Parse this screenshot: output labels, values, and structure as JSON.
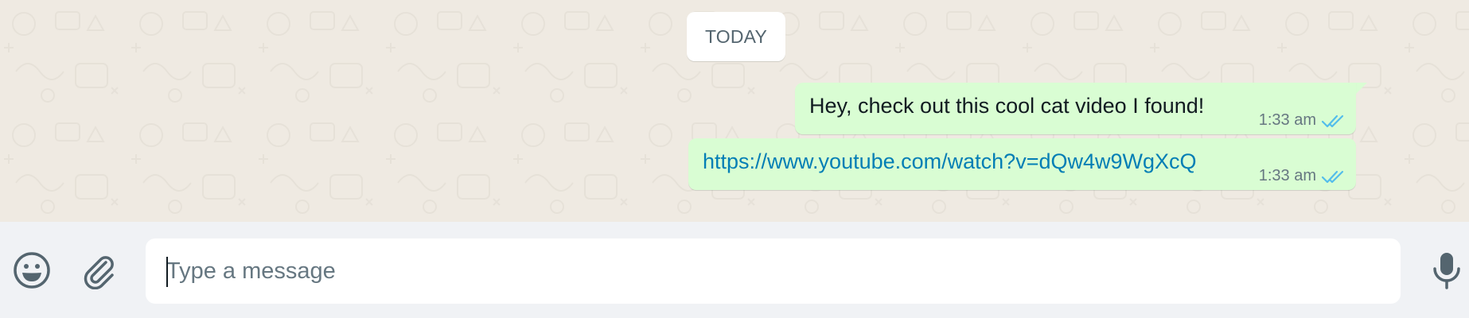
{
  "chat": {
    "date_label": "TODAY",
    "messages": [
      {
        "text": "Hey, check out this cool cat video I found!",
        "time": "1:33 am",
        "status": "double-check-read-icon",
        "is_link": false
      },
      {
        "text": "https://www.youtube.com/watch?v=dQw4w9WgXcQ",
        "time": "1:33 am",
        "status": "double-check-read-icon",
        "is_link": true
      }
    ]
  },
  "composer": {
    "placeholder": "Type a message",
    "value": "",
    "emoji_icon": "emoji-icon",
    "attach_icon": "paperclip-icon",
    "mic_icon": "microphone-icon"
  },
  "colors": {
    "chat_background": "#efeae2",
    "outgoing_bubble": "#d9fdd3",
    "footer_background": "#f0f2f5",
    "link": "#027eb5",
    "read_ticks": "#53bdeb",
    "icon": "#54656f"
  }
}
